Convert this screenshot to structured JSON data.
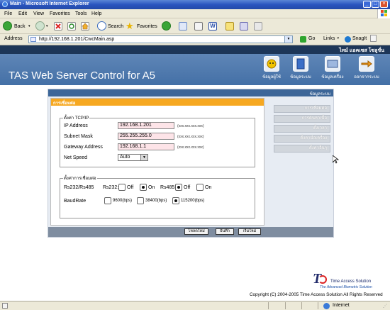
{
  "window": {
    "title": "Main - Microsoft Internet Explorer"
  },
  "menu": [
    "File",
    "Edit",
    "View",
    "Favorites",
    "Tools",
    "Help"
  ],
  "toolbar": {
    "back": "Back",
    "search": "Search",
    "favorites": "Favorites"
  },
  "address": {
    "label": "Address",
    "url": "http://192.168.1.201/CwcMain.asp",
    "go": "Go",
    "links": "Links",
    "snagit": "SnagIt"
  },
  "user": {
    "name": "ไทม์ แอคเซส โซลูชั่น"
  },
  "app": {
    "title": "TAS Web Server Control for A5"
  },
  "topnav": [
    {
      "label": "ข้อมูลผู้ใช้",
      "icon": "user-info-icon"
    },
    {
      "label": "ข้อมูลระบบ",
      "icon": "system-info-icon"
    },
    {
      "label": "ข้อมูลเครื่อง",
      "icon": "device-info-icon"
    },
    {
      "label": "ออกจากระบบ",
      "icon": "logout-icon"
    }
  ],
  "content": {
    "header": "ข้อมูลระบบ",
    "panel_title": "การเชื่อมต่อ"
  },
  "tcpip": {
    "legend": "ตั้งค่า TCP/IP",
    "fields": [
      {
        "label": "IP Address",
        "value": "192.168.1.201",
        "hint": "(xxx.xxx.xxx.xxx)"
      },
      {
        "label": "Subnet Mask",
        "value": "255.255.255.0",
        "hint": "(xxx.xxx.xxx.xxx)"
      },
      {
        "label": "Gateway Address",
        "value": "192.168.1.1",
        "hint": "(xxx.xxx.xxx.xxx)"
      }
    ],
    "netspeed": {
      "label": "Net Speed",
      "value": "Auto"
    }
  },
  "connection": {
    "legend": "ตั้งค่าการเชื่อมต่อ",
    "rs_label": "Rs232/Rs485",
    "rs232": {
      "label": "Rs232:",
      "off": "Off",
      "on": "On",
      "selected": "On"
    },
    "rs485": {
      "label": "Rs485:",
      "off": "Off",
      "on": "On",
      "selected": "Off"
    },
    "baud": {
      "label": "BaudRate",
      "options": [
        "9600(bps)",
        "38400(bps)",
        "115200(bps)"
      ],
      "selected": "115200(bps)"
    }
  },
  "buttons": {
    "reload": "โหลดใหม่",
    "save": "บันทึก",
    "restart": "เริ่มใหม่"
  },
  "sidenav": [
    "การเชื่อมต่อ",
    "การค้นหาเนื้อ",
    "ตั้งเวลา",
    "ตั้งค่ามือเครื่อง",
    "ตั้งค่าอื่นๆ"
  ],
  "footer": {
    "brand": "Time Access Solution",
    "tagline": "The Advanced Biometric Solution",
    "copyright": "Copyright (C) 2004-2005 Time Access Solution All Rights Reserved"
  },
  "status": {
    "zone": "Internet"
  }
}
